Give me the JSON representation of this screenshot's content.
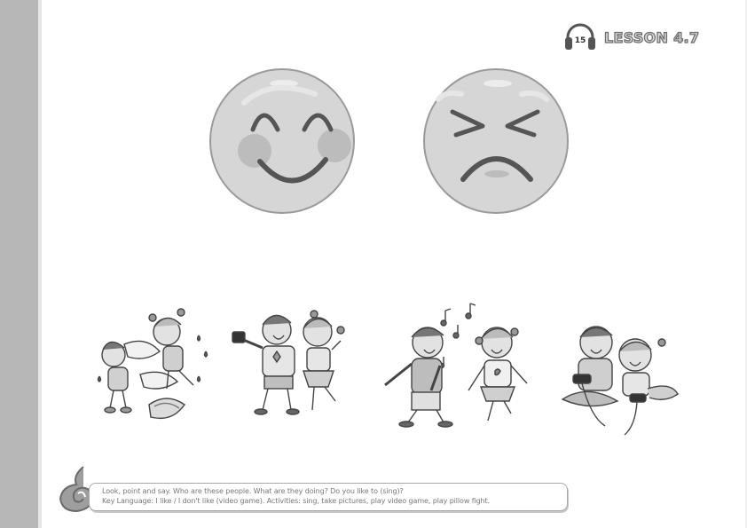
{
  "header": {
    "track_number": "15",
    "lesson_label": "LESSON 4.7"
  },
  "faces": [
    {
      "name": "happy-face",
      "meaning": "like"
    },
    {
      "name": "unhappy-face",
      "meaning": "don't like"
    }
  ],
  "activities": [
    {
      "name": "play pillow fight"
    },
    {
      "name": "take pictures"
    },
    {
      "name": "sing"
    },
    {
      "name": "play video game"
    }
  ],
  "instructions": {
    "line1": "Look, point and say. Who are these people. What are they doing? Do you like to (sing)?",
    "line2": "Key Language: I like / I don't like (video game). Activities: sing, take pictures, play video game, play pillow fight."
  },
  "colors": {
    "spine": "#b7b7b7",
    "face_fill": "#d6d6d6",
    "face_outline": "#9a9a9a",
    "feature": "#555555",
    "cheek": "#bcbcbc",
    "box_border": "#a8a8a8",
    "text": "#777777"
  },
  "icons": [
    "headphones-icon",
    "swirl-logo-icon"
  ]
}
